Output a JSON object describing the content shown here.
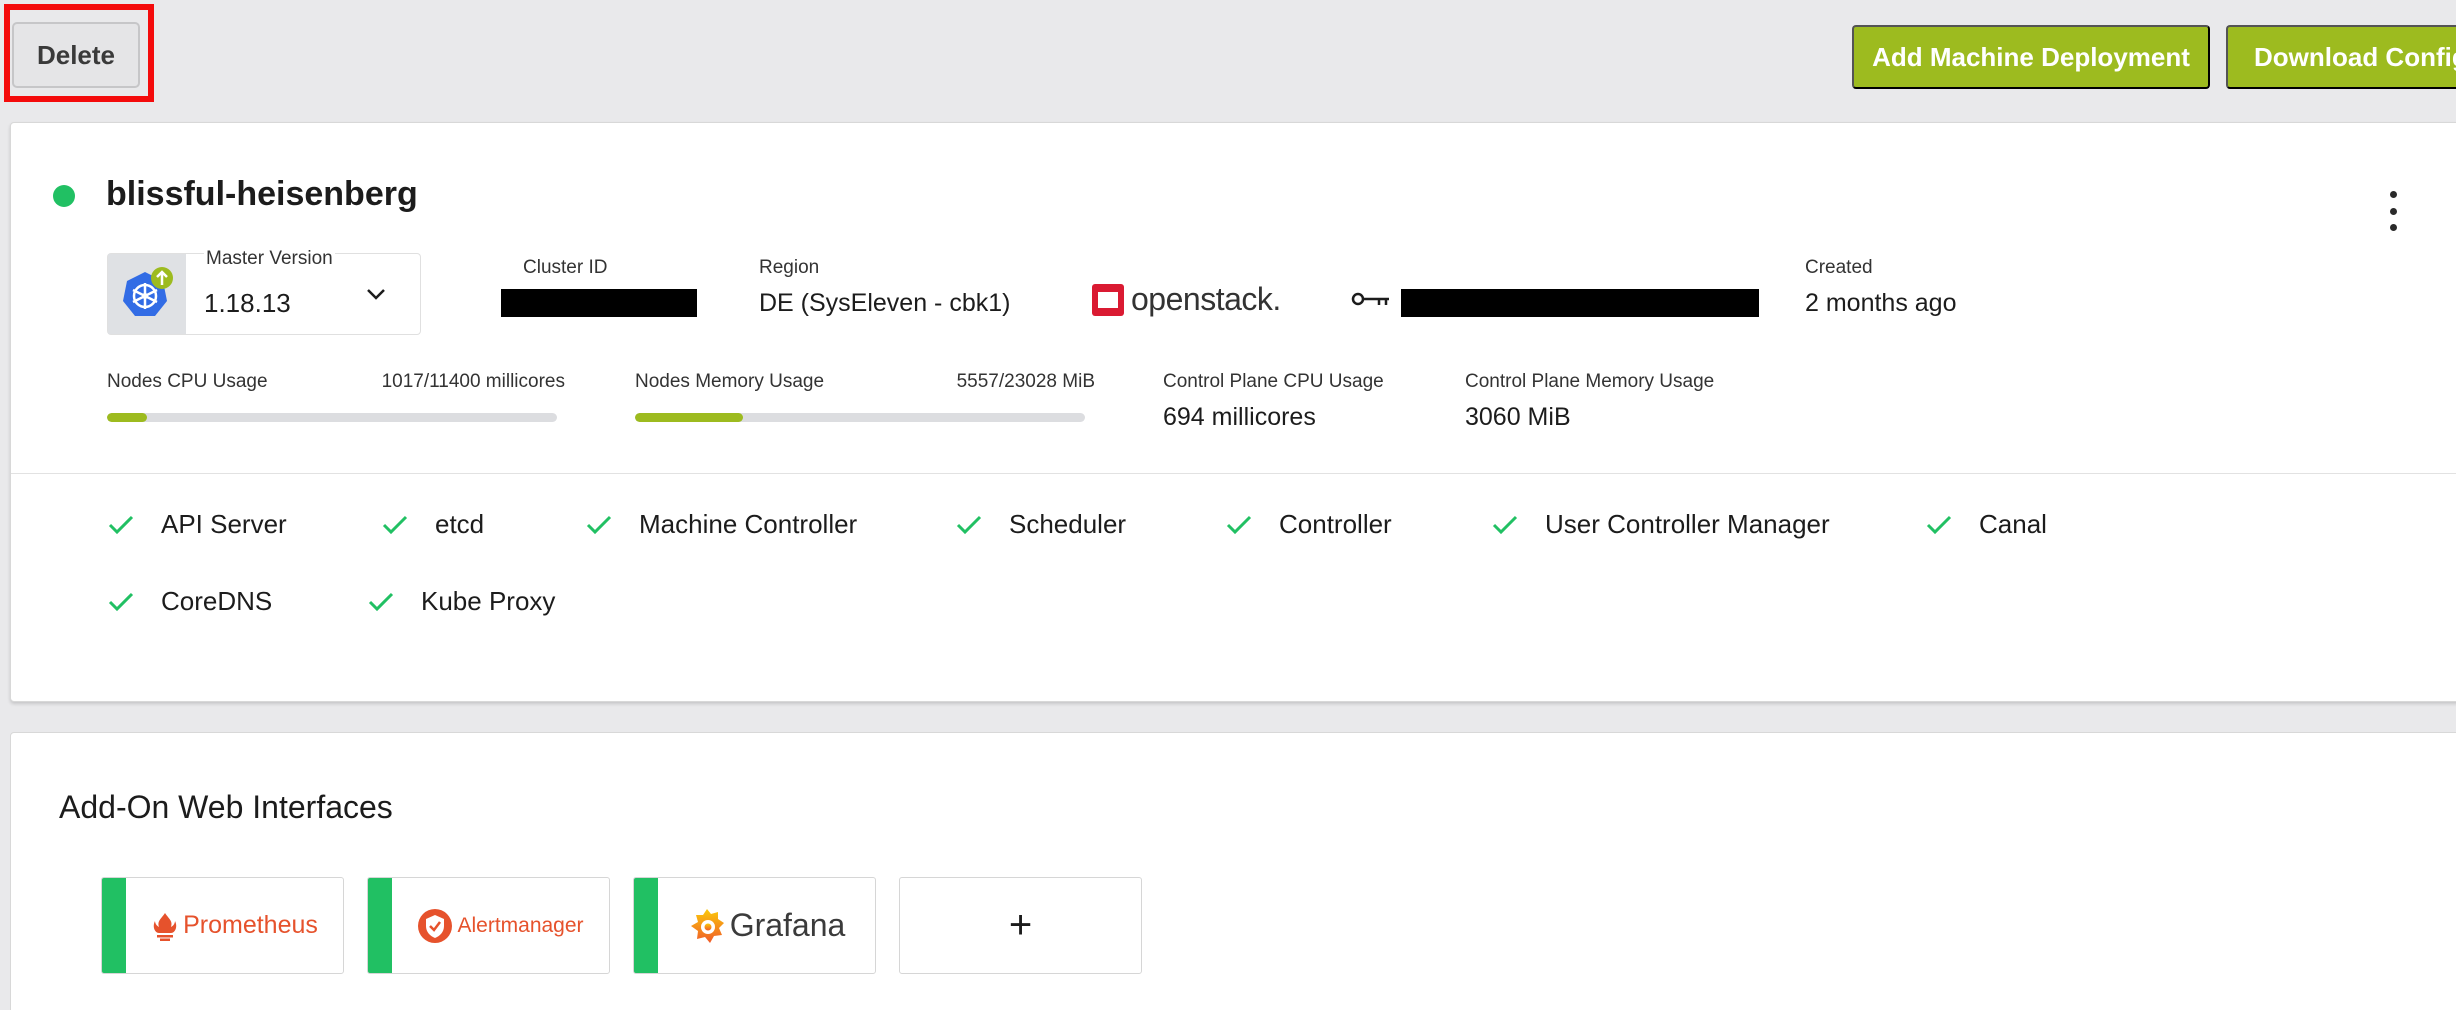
{
  "toolbar": {
    "delete_label": "Delete",
    "add_machine_deployment_label": "Add Machine Deployment",
    "download_config_label": "Download Config"
  },
  "cluster": {
    "name": "blissful-heisenberg",
    "status_color": "#21c063",
    "master_version_label": "Master Version",
    "master_version_value": "1.18.13",
    "cluster_id_label": "Cluster ID",
    "region_label": "Region",
    "region_value": "DE (SysEleven - cbk1)",
    "provider_logo_text": "openstack.",
    "created_label": "Created",
    "created_value": "2 months ago"
  },
  "usage": {
    "nodes_cpu_label": "Nodes CPU Usage",
    "nodes_cpu_value": "1017/11400 millicores",
    "nodes_cpu_fraction": 0.089,
    "nodes_memory_label": "Nodes Memory Usage",
    "nodes_memory_value": "5557/23028 MiB",
    "nodes_memory_fraction": 0.241,
    "cp_cpu_label": "Control Plane CPU Usage",
    "cp_cpu_value": "694 millicores",
    "cp_memory_label": "Control Plane Memory Usage",
    "cp_memory_value": "3060 MiB"
  },
  "health": {
    "items": [
      "API Server",
      "etcd",
      "Machine Controller",
      "Scheduler",
      "Controller",
      "User Controller Manager",
      "Canal",
      "CoreDNS",
      "Kube Proxy"
    ]
  },
  "addons": {
    "title": "Add-On Web Interfaces",
    "tiles": [
      "Prometheus",
      "Alertmanager",
      "Grafana"
    ],
    "add_label": "+"
  },
  "colors": {
    "accent": "#9dbb1f",
    "healthy": "#21c063",
    "highlight": "#f40b0b"
  }
}
